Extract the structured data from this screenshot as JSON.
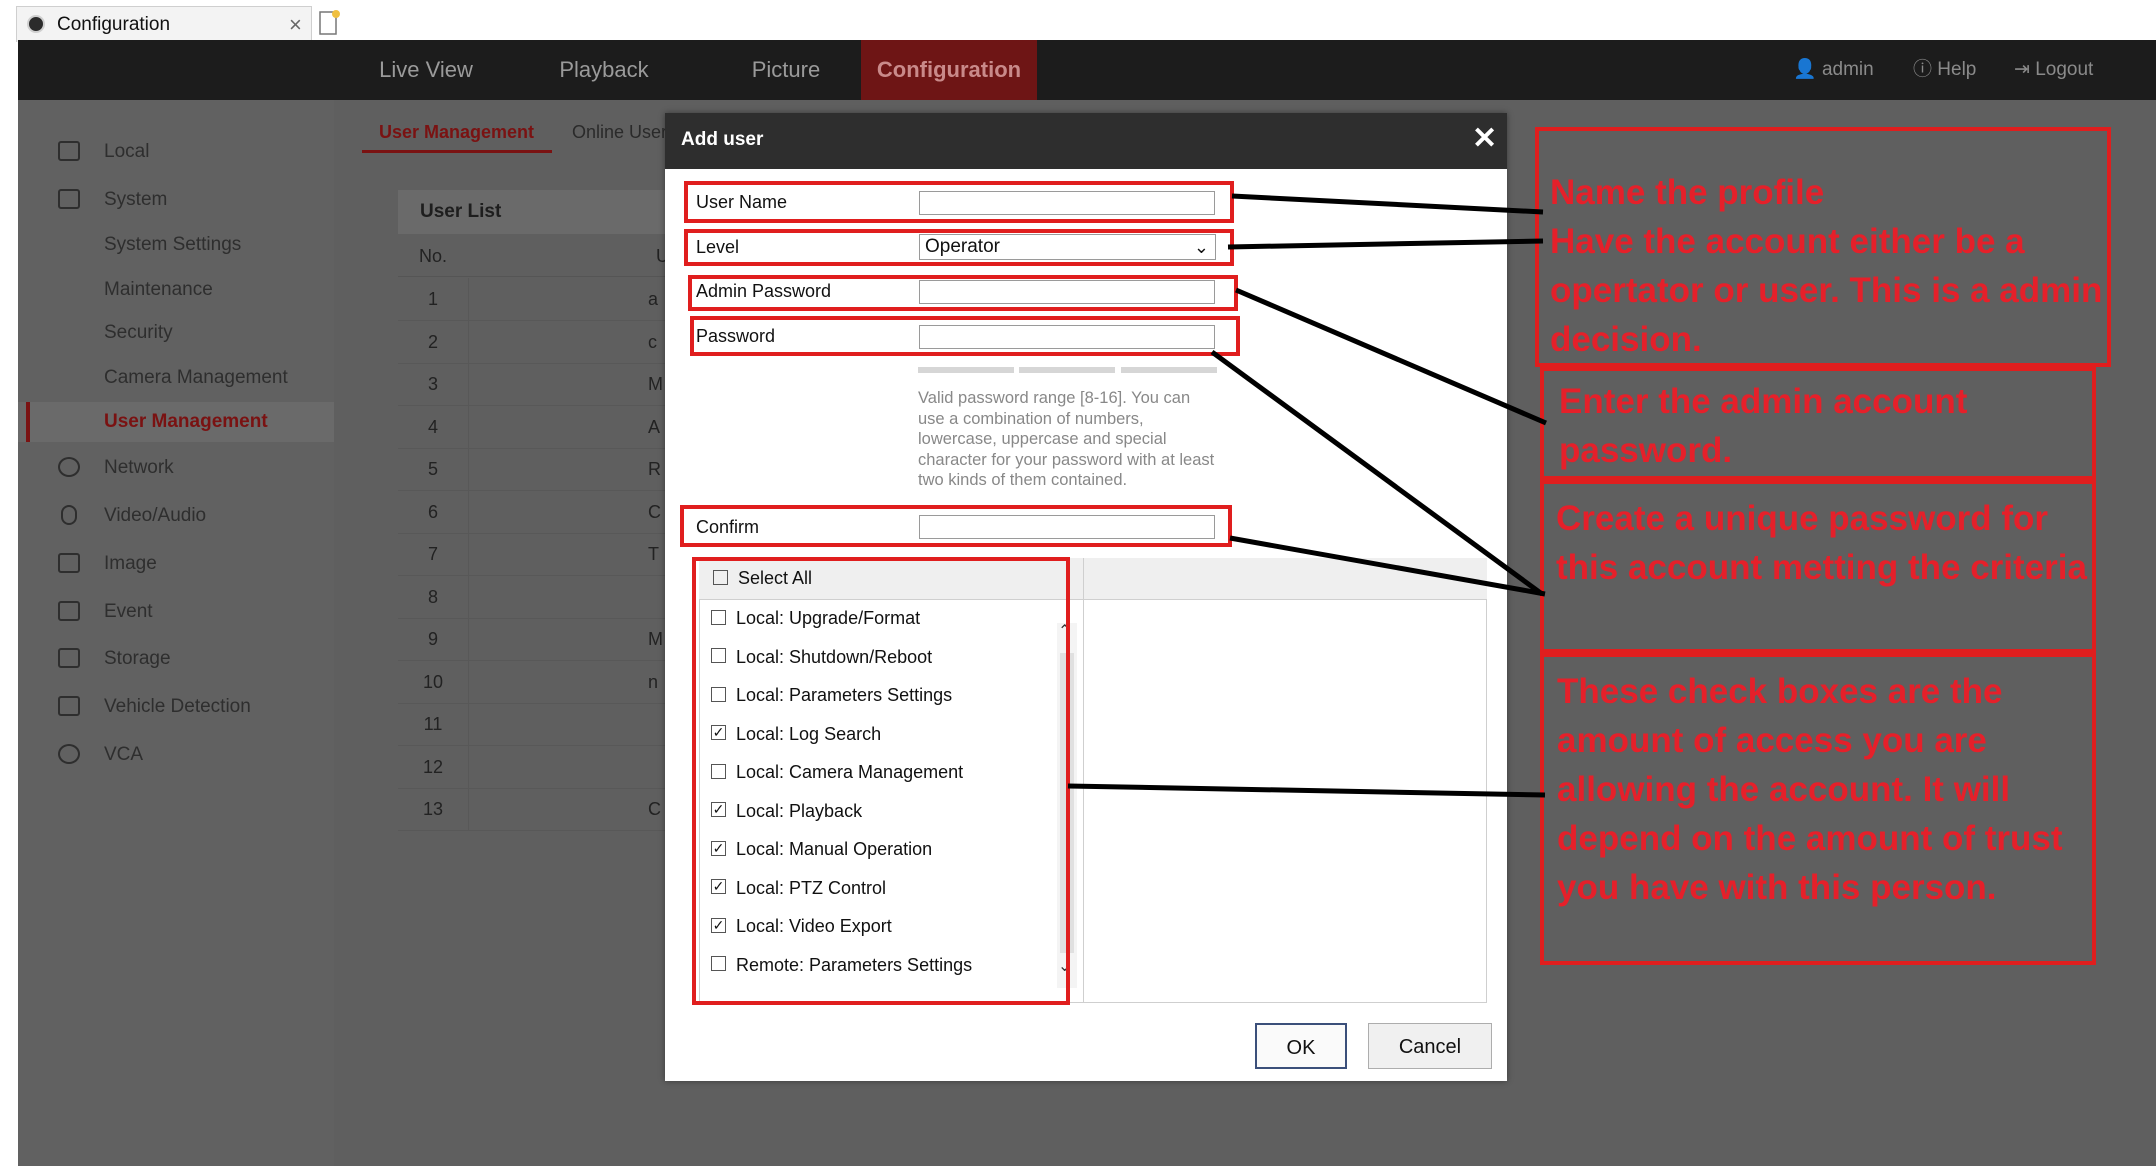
{
  "browser": {
    "tab_title": "Configuration",
    "tab_close": "×"
  },
  "topnav": {
    "items": [
      "Live View",
      "Playback",
      "Picture",
      "Configuration"
    ],
    "active": "Configuration",
    "user": "admin",
    "help": "Help",
    "logout": "Logout"
  },
  "sidebar": {
    "items": [
      {
        "label": "Local",
        "icon": "monitor-icon"
      },
      {
        "label": "System",
        "icon": "system-icon"
      },
      {
        "label": "System Settings"
      },
      {
        "label": "Maintenance"
      },
      {
        "label": "Security"
      },
      {
        "label": "Camera Management"
      },
      {
        "label": "User Management",
        "selected": true
      },
      {
        "label": "Network",
        "icon": "globe-icon"
      },
      {
        "label": "Video/Audio",
        "icon": "microphone-icon"
      },
      {
        "label": "Image",
        "icon": "image-icon"
      },
      {
        "label": "Event",
        "icon": "calendar-icon"
      },
      {
        "label": "Storage",
        "icon": "disk-icon"
      },
      {
        "label": "Vehicle Detection",
        "icon": "vehicle-icon"
      },
      {
        "label": "VCA",
        "icon": "vca-icon"
      }
    ]
  },
  "content": {
    "tabs": [
      "User Management",
      "Online User"
    ],
    "user_list_title": "User List",
    "columns": [
      "No.",
      "Use"
    ],
    "rows": [
      {
        "no": "1",
        "u": "a"
      },
      {
        "no": "2",
        "u": "c"
      },
      {
        "no": "3",
        "u": "M"
      },
      {
        "no": "4",
        "u": "A"
      },
      {
        "no": "5",
        "u": "R"
      },
      {
        "no": "6",
        "u": "C"
      },
      {
        "no": "7",
        "u": "T"
      },
      {
        "no": "8",
        "u": ""
      },
      {
        "no": "9",
        "u": "M"
      },
      {
        "no": "10",
        "u": "n"
      },
      {
        "no": "11",
        "u": ""
      },
      {
        "no": "12",
        "u": ""
      },
      {
        "no": "13",
        "u": "C"
      }
    ]
  },
  "dialog": {
    "title": "Add user",
    "close": "✕",
    "user_name_label": "User Name",
    "user_name_value": "",
    "level_label": "Level",
    "level_value": "Operator",
    "admin_password_label": "Admin Password",
    "password_label": "Password",
    "password_hint": "Valid password range [8-16]. You can use a combination of numbers, lowercase, uppercase and special character for your password with at least two kinds of them contained.",
    "confirm_label": "Confirm",
    "select_all": "Select All",
    "permissions": [
      {
        "label": "Local: Upgrade/Format",
        "checked": false
      },
      {
        "label": "Local: Shutdown/Reboot",
        "checked": false
      },
      {
        "label": "Local: Parameters Settings",
        "checked": false
      },
      {
        "label": "Local: Log Search",
        "checked": true
      },
      {
        "label": "Local: Camera Management",
        "checked": false
      },
      {
        "label": "Local: Playback",
        "checked": true
      },
      {
        "label": "Local: Manual Operation",
        "checked": true
      },
      {
        "label": "Local: PTZ Control",
        "checked": true
      },
      {
        "label": "Local: Video Export",
        "checked": true
      },
      {
        "label": "Remote: Parameters Settings",
        "checked": false
      }
    ],
    "ok": "OK",
    "cancel": "Cancel"
  },
  "annotations": [
    "Name the profile\nHave the account either be a opertator or user. This is a admin decision.",
    "Enter the admin account password.",
    "Create a unique password for this account metting the criteria",
    "These check boxes are the amount of access you are allowing the account. It will depend on the amount of trust you have with this person."
  ],
  "colors": {
    "annotation_red": "#e01e1e",
    "nav_active": "#6e1515",
    "accent": "#7a1212"
  }
}
